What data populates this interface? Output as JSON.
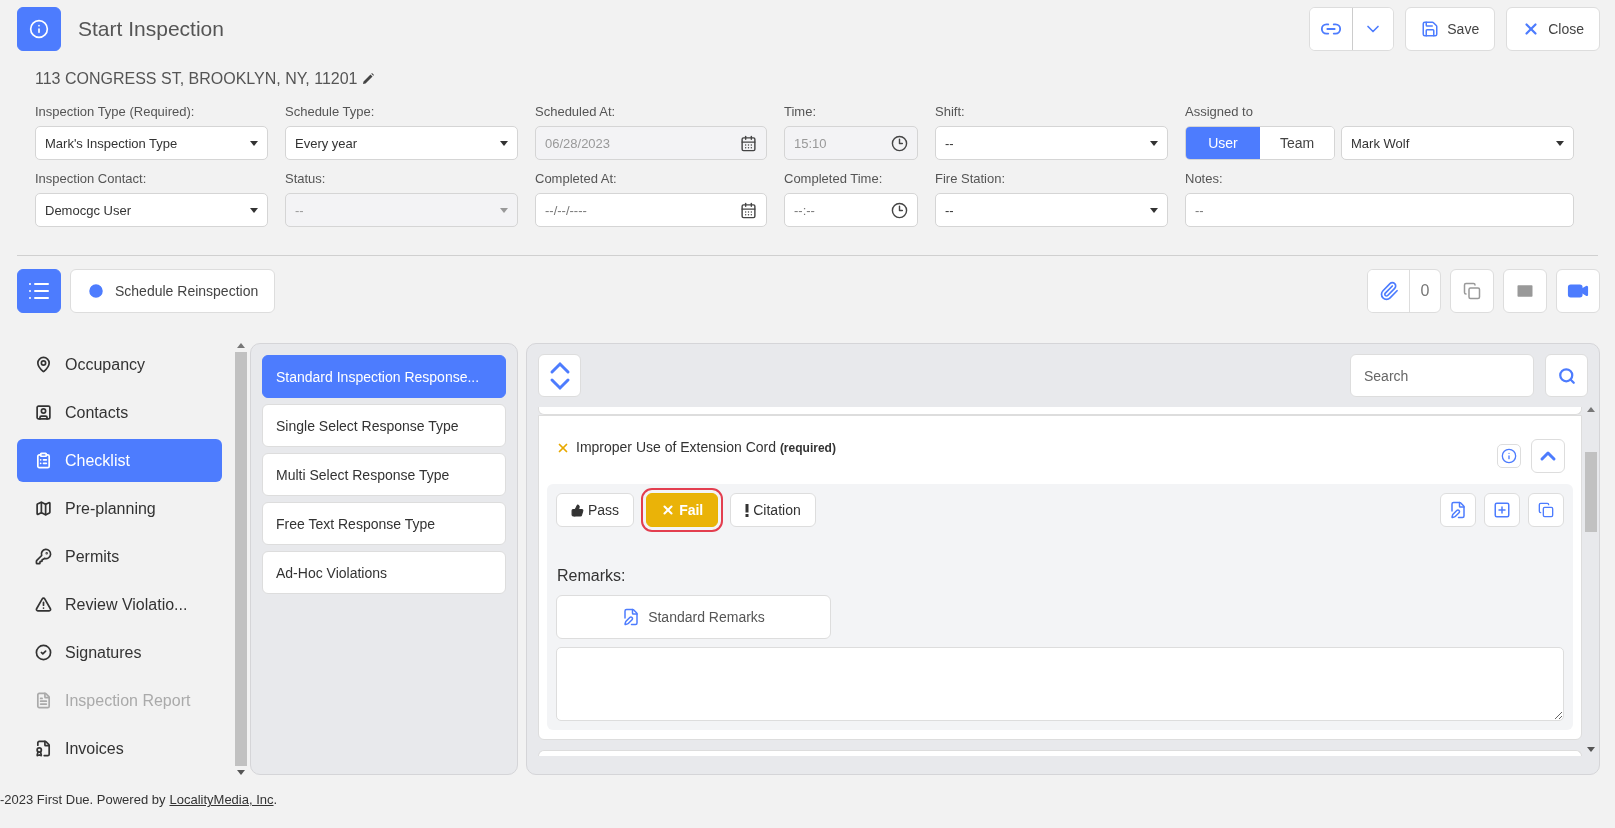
{
  "header": {
    "title": "Start Inspection",
    "address": "113 CONGRESS ST, BROOKLYN, NY, 11201",
    "save": "Save",
    "close": "Close"
  },
  "fields": [
    {
      "label": "Inspection Type (Required):",
      "kind": "select",
      "value": "Mark's Inspection Type",
      "disabled": false
    },
    {
      "label": "Schedule Type:",
      "kind": "select",
      "value": "Every year",
      "disabled": false
    },
    {
      "label": "Scheduled At:",
      "kind": "date",
      "value": "06/28/2023",
      "disabled": true
    },
    {
      "label": "Time:",
      "kind": "time",
      "value": "15:10",
      "disabled": true
    },
    {
      "label": "Shift:",
      "kind": "select",
      "value": "--",
      "disabled": false
    },
    {
      "label": "Assigned to",
      "kind": "assign",
      "options": [
        {
          "label": "User",
          "selected": true
        },
        {
          "label": "Team",
          "selected": false
        }
      ],
      "value": "Mark Wolf",
      "disabled": false
    },
    {
      "label": "Inspection Contact:",
      "kind": "select",
      "value": "Democgc User",
      "disabled": false
    },
    {
      "label": "Status:",
      "kind": "select",
      "value": "--",
      "disabled": true
    },
    {
      "label": "Completed At:",
      "kind": "date",
      "placeholder": "--/--/----",
      "disabled": false
    },
    {
      "label": "Completed Time:",
      "kind": "time",
      "placeholder": "--:--",
      "disabled": false
    },
    {
      "label": "Fire Station:",
      "kind": "select",
      "value": "--",
      "disabled": false
    },
    {
      "label": "Notes:",
      "kind": "text",
      "placeholder": "--",
      "disabled": false
    }
  ],
  "toolbar": {
    "schedule_button": "Schedule Reinspection",
    "attachment_count": "0"
  },
  "sidebar": {
    "items": [
      {
        "label": "Occupancy",
        "selected": false,
        "disabled": false
      },
      {
        "label": "Contacts",
        "selected": false,
        "disabled": false
      },
      {
        "label": "Checklist",
        "selected": true,
        "disabled": false
      },
      {
        "label": "Pre-planning",
        "selected": false,
        "disabled": false
      },
      {
        "label": "Permits",
        "selected": false,
        "disabled": false
      },
      {
        "label": "Review Violatio...",
        "selected": false,
        "disabled": false
      },
      {
        "label": "Signatures",
        "selected": false,
        "disabled": false
      },
      {
        "label": "Inspection Report",
        "selected": false,
        "disabled": true
      },
      {
        "label": "Invoices",
        "selected": false,
        "disabled": false
      }
    ]
  },
  "sections": [
    {
      "label": "Standard Inspection Response...",
      "selected": true
    },
    {
      "label": "Single Select Response Type",
      "selected": false
    },
    {
      "label": "Multi Select Response Type",
      "selected": false
    },
    {
      "label": "Free Text Response Type",
      "selected": false
    },
    {
      "label": "Ad-Hoc Violations",
      "selected": false
    }
  ],
  "checklist": {
    "search_placeholder": "Search",
    "item": {
      "title": "Improper Use of Extension Cord",
      "tag": "(required)",
      "responses": [
        {
          "label": "Pass",
          "selected": false
        },
        {
          "label": "Fail",
          "selected": true
        },
        {
          "label": "Citation",
          "selected": false
        }
      ],
      "remarks_label": "Remarks:",
      "standard_remarks": "Standard Remarks"
    }
  },
  "footer": {
    "text": "-2023 First Due. Powered by",
    "link": "LocalityMedia, Inc",
    "suffix": "."
  }
}
